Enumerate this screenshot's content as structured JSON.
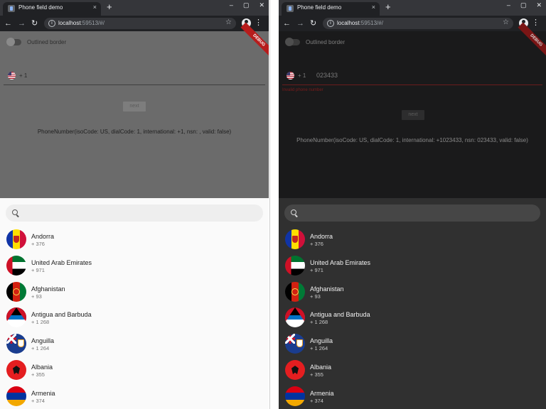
{
  "browser": {
    "tab_title": "Phone field demo",
    "tab_close": "×",
    "new_tab": "+",
    "window_controls": [
      "–",
      "▢",
      "✕"
    ],
    "url_host": "localhost",
    "url_rest": ":59513/#/",
    "back_icon": "←",
    "forward_icon": "→",
    "reload_icon": "↻",
    "star_icon": "☆",
    "menu_icon": "⋮"
  },
  "app": {
    "switch_label": "Outlined border",
    "debug_banner": "DEBUG",
    "dial_code": "+ 1",
    "next_label": "next"
  },
  "light": {
    "phone_value": "",
    "phone_number_text": "PhoneNumber(isoCode: US, dialCode: 1, international: +1, nsn: , valid: false)"
  },
  "dark": {
    "phone_value": "023433",
    "error_text": "Invalid phone number",
    "phone_number_text": "PhoneNumber(isoCode: US, dialCode: 1, international: +1023433, nsn: 023433, valid: false)"
  },
  "countries": [
    {
      "name": "Andorra",
      "code": "+ 376",
      "flag": "ad"
    },
    {
      "name": "United Arab Emirates",
      "code": "+ 971",
      "flag": "ae"
    },
    {
      "name": "Afghanistan",
      "code": "+ 93",
      "flag": "af"
    },
    {
      "name": "Antigua and Barbuda",
      "code": "+ 1 268",
      "flag": "ag"
    },
    {
      "name": "Anguilla",
      "code": "+ 1 264",
      "flag": "ai"
    },
    {
      "name": "Albania",
      "code": "+ 355",
      "flag": "al"
    },
    {
      "name": "Armenia",
      "code": "+ 374",
      "flag": "am"
    }
  ]
}
